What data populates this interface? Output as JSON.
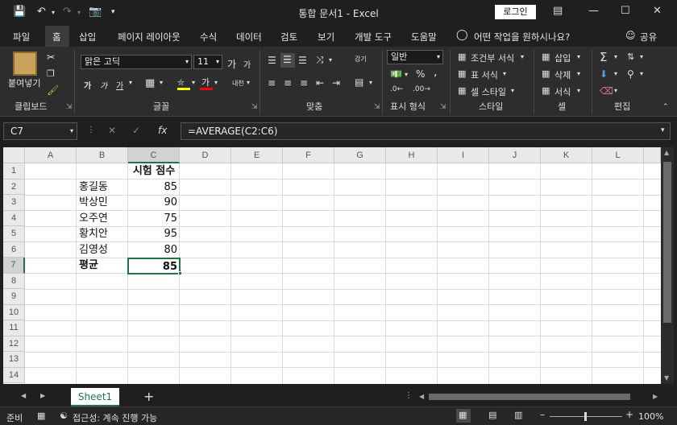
{
  "title_bar": {
    "title": "통합 문서1  -  Excel",
    "login_label": "로그인"
  },
  "menu": {
    "items": [
      "파일",
      "홈",
      "삽입",
      "페이지 레이아웃",
      "수식",
      "데이터",
      "검토",
      "보기",
      "개발 도구",
      "도움말"
    ],
    "search_placeholder": "어떤 작업을 원하시나요?",
    "share_label": "공유"
  },
  "ribbon": {
    "clipboard": {
      "group": "클립보드",
      "paste": "붙여넣기"
    },
    "font": {
      "group": "글꼴",
      "name": "맑은 고딕",
      "size": "11",
      "bold": "가",
      "italic": "가",
      "underline": "가",
      "grow": "가",
      "shrink": "가",
      "color_text": "가",
      "phonetic": "내천"
    },
    "alignment": {
      "group": "맞춤",
      "wrap": "감기"
    },
    "number": {
      "group": "표시 형식",
      "format": "일반",
      "percent": "%",
      "comma": ","
    },
    "styles": {
      "group": "스타일",
      "cond": "조건부 서식",
      "table": "표 서식",
      "cell": "셀 스타일"
    },
    "cells": {
      "group": "셀",
      "insert": "삽입",
      "delete": "삭제",
      "format": "서식"
    },
    "editing": {
      "group": "편집"
    }
  },
  "formula_bar": {
    "name_box": "C7",
    "fx": "fx",
    "formula": "=AVERAGE(C2:C6)"
  },
  "sheet": {
    "columns": [
      "A",
      "B",
      "C",
      "D",
      "E",
      "F",
      "G",
      "H",
      "I",
      "J",
      "K",
      "L"
    ],
    "rows": [
      "1",
      "2",
      "3",
      "4",
      "5",
      "6",
      "7",
      "8",
      "9",
      "10",
      "11",
      "12",
      "13",
      "14"
    ],
    "header_c1": "시험 점수",
    "names": [
      "홍길동",
      "박상민",
      "오주연",
      "황치안",
      "김영성"
    ],
    "scores": [
      "85",
      "90",
      "75",
      "95",
      "80"
    ],
    "avg_label": "평균",
    "avg_value": "85",
    "selected_cell": "C7"
  },
  "tabs": {
    "sheet1": "Sheet1",
    "add": "+"
  },
  "status": {
    "ready": "준비",
    "accessibility": "접근성: 계속 진행 가능",
    "zoom": "100%"
  },
  "colors": {
    "accent": "#217346",
    "dark": "#1f1f1f",
    "ribbon": "#2d2d2d"
  }
}
